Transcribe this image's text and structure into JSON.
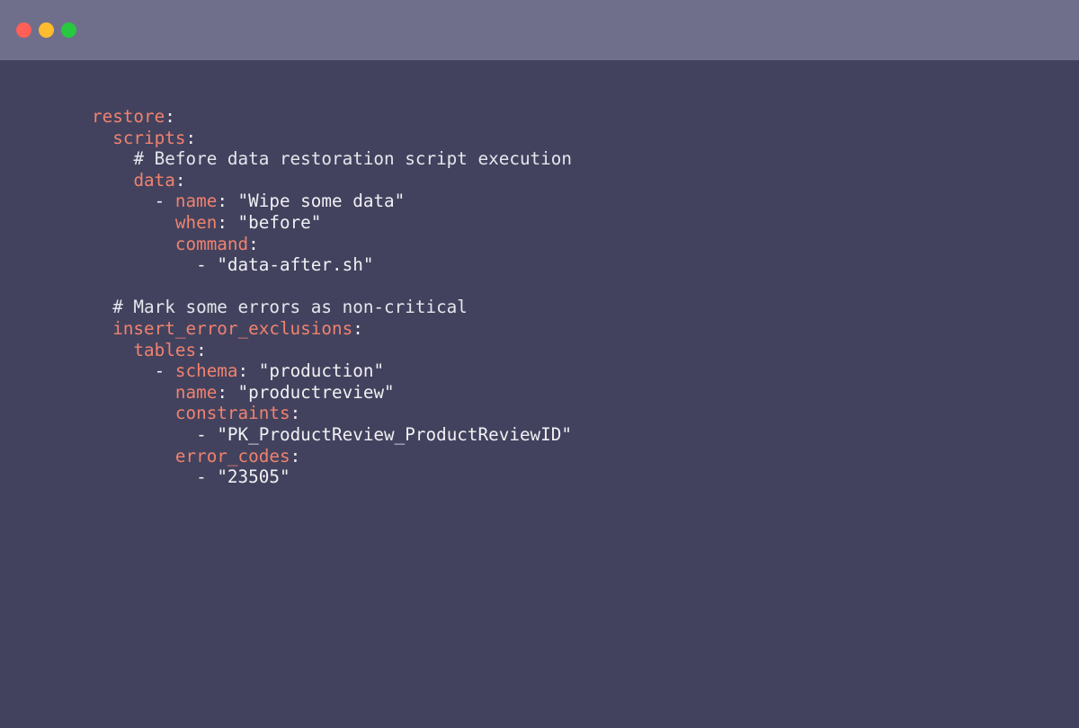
{
  "window": {
    "controls": [
      {
        "name": "close",
        "color": "#fe5f57"
      },
      {
        "name": "minimize",
        "color": "#febc2e"
      },
      {
        "name": "maximize",
        "color": "#28c840"
      }
    ]
  },
  "colors": {
    "background": "#42425e",
    "titlebar": "#6f6f8c",
    "key": "#f0826e",
    "text": "#f0f0f4"
  },
  "code": {
    "lines": [
      {
        "indent": "",
        "tokens": [
          {
            "t": "key",
            "v": "restore"
          },
          {
            "t": "punct",
            "v": ":"
          }
        ]
      },
      {
        "indent": "  ",
        "tokens": [
          {
            "t": "key",
            "v": "scripts"
          },
          {
            "t": "punct",
            "v": ":"
          }
        ]
      },
      {
        "indent": "    ",
        "tokens": [
          {
            "t": "comment",
            "v": "# Before data restoration script execution"
          }
        ]
      },
      {
        "indent": "    ",
        "tokens": [
          {
            "t": "key",
            "v": "data"
          },
          {
            "t": "punct",
            "v": ":"
          }
        ]
      },
      {
        "indent": "      ",
        "tokens": [
          {
            "t": "punct",
            "v": "- "
          },
          {
            "t": "key",
            "v": "name"
          },
          {
            "t": "punct",
            "v": ": "
          },
          {
            "t": "str",
            "v": "\"Wipe some data\""
          }
        ]
      },
      {
        "indent": "        ",
        "tokens": [
          {
            "t": "key",
            "v": "when"
          },
          {
            "t": "punct",
            "v": ": "
          },
          {
            "t": "str",
            "v": "\"before\""
          }
        ]
      },
      {
        "indent": "        ",
        "tokens": [
          {
            "t": "key",
            "v": "command"
          },
          {
            "t": "punct",
            "v": ":"
          }
        ]
      },
      {
        "indent": "          ",
        "tokens": [
          {
            "t": "punct",
            "v": "- "
          },
          {
            "t": "str",
            "v": "\"data-after.sh\""
          }
        ]
      },
      {
        "indent": "",
        "tokens": []
      },
      {
        "indent": "  ",
        "tokens": [
          {
            "t": "comment",
            "v": "# Mark some errors as non-critical"
          }
        ]
      },
      {
        "indent": "  ",
        "tokens": [
          {
            "t": "key",
            "v": "insert_error_exclusions"
          },
          {
            "t": "punct",
            "v": ":"
          }
        ]
      },
      {
        "indent": "    ",
        "tokens": [
          {
            "t": "key",
            "v": "tables"
          },
          {
            "t": "punct",
            "v": ":"
          }
        ]
      },
      {
        "indent": "      ",
        "tokens": [
          {
            "t": "punct",
            "v": "- "
          },
          {
            "t": "key",
            "v": "schema"
          },
          {
            "t": "punct",
            "v": ": "
          },
          {
            "t": "str",
            "v": "\"production\""
          }
        ]
      },
      {
        "indent": "        ",
        "tokens": [
          {
            "t": "key",
            "v": "name"
          },
          {
            "t": "punct",
            "v": ": "
          },
          {
            "t": "str",
            "v": "\"productreview\""
          }
        ]
      },
      {
        "indent": "        ",
        "tokens": [
          {
            "t": "key",
            "v": "constraints"
          },
          {
            "t": "punct",
            "v": ":"
          }
        ]
      },
      {
        "indent": "          ",
        "tokens": [
          {
            "t": "punct",
            "v": "- "
          },
          {
            "t": "str",
            "v": "\"PK_ProductReview_ProductReviewID\""
          }
        ]
      },
      {
        "indent": "        ",
        "tokens": [
          {
            "t": "key",
            "v": "error_codes"
          },
          {
            "t": "punct",
            "v": ":"
          }
        ]
      },
      {
        "indent": "          ",
        "tokens": [
          {
            "t": "punct",
            "v": "- "
          },
          {
            "t": "str",
            "v": "\"23505\""
          }
        ]
      }
    ]
  }
}
